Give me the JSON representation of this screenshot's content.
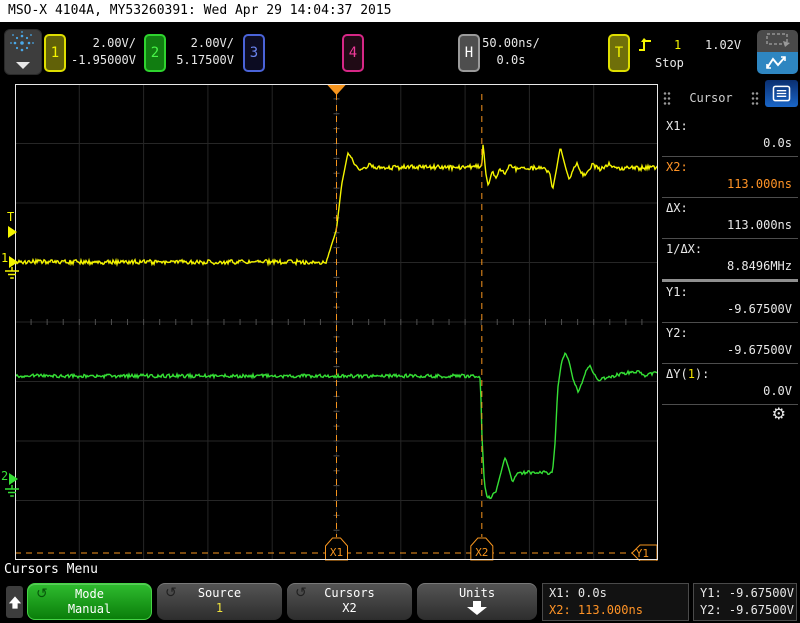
{
  "title_bar": {
    "text": "MSO-X 4104A, MY53260391: Wed Apr 29 14:04:37 2015"
  },
  "toolbar": {
    "channels": [
      {
        "num": "1",
        "scale": "2.00V/",
        "offset": "-1.95000V",
        "color": "#f5f500"
      },
      {
        "num": "2",
        "scale": "2.00V/",
        "offset": "5.17500V",
        "color": "#2ed42e"
      },
      {
        "num": "3",
        "color": "#4a63d8"
      },
      {
        "num": "4",
        "color": "#d62786"
      }
    ],
    "horizontal": {
      "button": "H",
      "scale": "50.00ns/",
      "delay": "0.0s"
    },
    "trigger": {
      "button": "T",
      "source": "1",
      "mode": "Stop",
      "level": "1.02V"
    }
  },
  "cursor_panel": {
    "title": "Cursor",
    "rows": [
      {
        "label": "X1:",
        "value": "0.0s"
      },
      {
        "label": "X2:",
        "value": "113.000ns"
      },
      {
        "label": "ΔX:",
        "value": "113.000ns"
      },
      {
        "label": "1/ΔX:",
        "value": "8.8496MHz"
      },
      {
        "label": "Y1:",
        "value": "-9.67500V"
      },
      {
        "label": "Y2:",
        "value": "-9.67500V"
      }
    ],
    "dy_row": {
      "pre": "ΔY(",
      "chan": "1",
      "post": "):",
      "value": "0.0V"
    }
  },
  "menu": {
    "title": "Cursors Menu",
    "buttons": [
      {
        "label": "Mode",
        "value": "Manual"
      },
      {
        "label": "Source",
        "value": "1"
      },
      {
        "label": "Cursors",
        "value": "X2"
      },
      {
        "label": "Units"
      }
    ],
    "readout_x": {
      "line1": "X1: 0.0s",
      "line2": "X2: 113.000ns"
    },
    "readout_y": {
      "line1": "Y1: -9.67500V",
      "line2": "Y2: -9.67500V"
    }
  },
  "icons": {
    "gear": "⚙",
    "rotate": "↺"
  },
  "scope": {
    "cursor_tags": [
      "X1",
      "X2",
      "Y1"
    ],
    "trigger_level_marker": "T",
    "ch1_marker": "1",
    "ch2_marker": "2",
    "accent_orange": "#f5941e"
  },
  "chart_data": {
    "type": "line",
    "title": "Oscilloscope capture, cursors on CH1/CH2 edges",
    "x_unit": "ns",
    "y_unit": "V",
    "timebase_ns_per_div": 50,
    "x_range_ns": [
      -250,
      250
    ],
    "divisions": {
      "x": 10,
      "y": 8
    },
    "grid": true,
    "trigger": {
      "source": 1,
      "level_v": 1.02,
      "slope": "rising",
      "t_ns": 0,
      "mode": "Stop"
    },
    "cursors": {
      "x1_ns": 0,
      "x2_ns": 113,
      "dx_ns": 113,
      "one_over_dx": "8.8496MHz",
      "y1_v": -9.675,
      "y2_v": -9.675,
      "dy_v": 0.0
    },
    "series": [
      {
        "name": "CH1",
        "color": "#f5f500",
        "volts_per_div": 2.0,
        "offset_v": -1.95,
        "points": [
          [
            -250,
            0
          ],
          [
            -8,
            0
          ],
          [
            0,
            1.1
          ],
          [
            4,
            2.6
          ],
          [
            9,
            3.7
          ],
          [
            14,
            3.3
          ],
          [
            19,
            3.05
          ],
          [
            25,
            3.25
          ],
          [
            35,
            3.15
          ],
          [
            60,
            3.2
          ],
          [
            90,
            3.18
          ],
          [
            110,
            3.2
          ],
          [
            113,
            3.25
          ],
          [
            114,
            4.0
          ],
          [
            116,
            3.0
          ],
          [
            118,
            2.55
          ],
          [
            121,
            3.05
          ],
          [
            124,
            2.8
          ],
          [
            127,
            3.15
          ],
          [
            131,
            2.95
          ],
          [
            135,
            3.3
          ],
          [
            140,
            3.1
          ],
          [
            145,
            3.22
          ],
          [
            152,
            3.15
          ],
          [
            160,
            3.2
          ],
          [
            166,
            2.95
          ],
          [
            168,
            2.42
          ],
          [
            171,
            3.1
          ],
          [
            174,
            3.87
          ],
          [
            178,
            3.2
          ],
          [
            181,
            2.76
          ],
          [
            184,
            3.1
          ],
          [
            187,
            3.33
          ],
          [
            190,
            3.0
          ],
          [
            193,
            2.92
          ],
          [
            199,
            3.26
          ],
          [
            205,
            3.1
          ],
          [
            212,
            3.28
          ],
          [
            220,
            3.12
          ],
          [
            228,
            3.22
          ],
          [
            236,
            3.15
          ],
          [
            243,
            3.2
          ],
          [
            250,
            3.18
          ]
        ]
      },
      {
        "name": "CH2",
        "color": "#35e035",
        "volts_per_div": 2.0,
        "offset_v": 5.175,
        "points": [
          [
            -250,
            3.43
          ],
          [
            111,
            3.43
          ],
          [
            112,
            3.3
          ],
          [
            113,
            1.5
          ],
          [
            115,
            -0.2
          ],
          [
            117,
            -0.62
          ],
          [
            120,
            -0.64
          ],
          [
            124,
            -0.45
          ],
          [
            128,
            0.2
          ],
          [
            131,
            0.71
          ],
          [
            134,
            0.3
          ],
          [
            137,
            -0.15
          ],
          [
            139,
            0.05
          ],
          [
            142,
            0.2
          ],
          [
            145,
            0.17
          ],
          [
            150,
            0.2
          ],
          [
            155,
            0.15
          ],
          [
            160,
            0.18
          ],
          [
            165,
            0.17
          ],
          [
            168,
            0.2
          ],
          [
            170,
            1.2
          ],
          [
            172,
            3.0
          ],
          [
            175,
            3.9
          ],
          [
            178,
            4.2
          ],
          [
            181,
            3.9
          ],
          [
            184,
            3.3
          ],
          [
            188,
            2.9
          ],
          [
            191,
            3.2
          ],
          [
            194,
            3.6
          ],
          [
            197,
            3.8
          ],
          [
            200,
            3.5
          ],
          [
            204,
            3.3
          ],
          [
            208,
            3.35
          ],
          [
            214,
            3.42
          ],
          [
            220,
            3.48
          ],
          [
            228,
            3.55
          ],
          [
            234,
            3.58
          ],
          [
            240,
            3.45
          ],
          [
            246,
            3.5
          ],
          [
            250,
            3.55
          ]
        ]
      }
    ]
  }
}
